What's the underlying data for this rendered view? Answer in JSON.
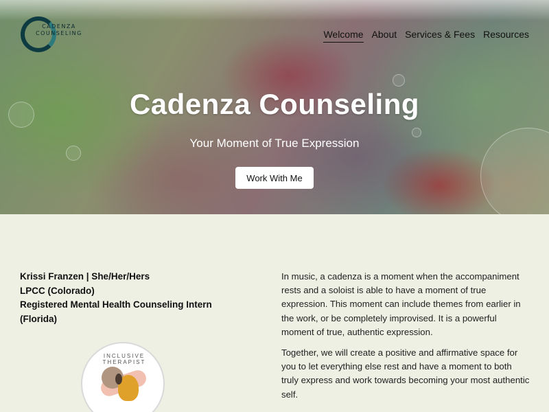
{
  "brand": {
    "logo_line1": "CADENZA",
    "logo_line2": "COUNSELING"
  },
  "nav": {
    "items": [
      {
        "label": "Welcome",
        "active": true
      },
      {
        "label": "About",
        "active": false
      },
      {
        "label": "Services & Fees",
        "active": false
      },
      {
        "label": "Resources",
        "active": false
      }
    ]
  },
  "hero": {
    "title": "Cadenza Counseling",
    "subtitle": "Your Moment of True Expression",
    "cta_label": "Work With Me"
  },
  "intro": {
    "name_line": "Krissi Franzen | She/Her/Hers",
    "credential_1": "LPCC (Colorado)",
    "credential_2": "Registered Mental Health Counseling Intern",
    "credential_2b": "(Florida)"
  },
  "badge": {
    "text": "INCLUSIVE THERAPIST"
  },
  "body": {
    "paragraph_1": "In music, a cadenza is a moment when the accompaniment rests and a soloist is able to have a moment of true expression. This moment can include themes from earlier in the work, or be completely improvised. It is a powerful moment of true, authentic expression.",
    "paragraph_2": "Together, we will create a positive and affirmative space for you to let everything else rest and have a moment to both truly express and work towards becoming your most authentic self."
  },
  "colors": {
    "page_bg": "#eef0e4",
    "logo_teal": "#0e3b42",
    "hero_text": "#ffffff"
  }
}
